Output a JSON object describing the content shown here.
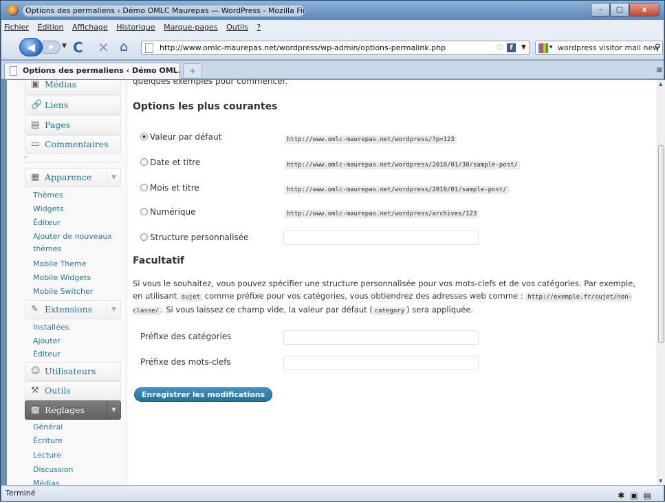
{
  "window": {
    "title": "Options des permaliens ‹ Démo OMLC Maurepas — WordPress - Mozilla Firefox",
    "min": "–",
    "max": "□",
    "close": "x"
  },
  "menubar": [
    "Fichier",
    "Édition",
    "Affichage",
    "Historique",
    "Marque-pages",
    "Outils",
    "?"
  ],
  "nav": {
    "url": "http://www.omlc-maurepas.net/wordpress/wp-admin/options-permalink.php",
    "search": "wordpress visitor mail new"
  },
  "tabs": [
    {
      "label": "Options des permaliens ‹ Démo OML..."
    }
  ],
  "sidebar": {
    "medias": "Médias",
    "liens": "Liens",
    "pages": "Pages",
    "commentaires": "Commentaires",
    "apparence": "Apparence",
    "apparence_sub": [
      "Thèmes",
      "Widgets",
      "Éditeur",
      "Ajouter de nouveaux",
      "thèmes",
      "Mobile Theme",
      "Mobile Widgets",
      "Mobile Switcher"
    ],
    "extensions": "Extensions",
    "extensions_sub": [
      "Installées",
      "Ajouter",
      "Éditeur"
    ],
    "utilisateurs": "Utilisateurs",
    "outils": "Outils",
    "reglages": "Réglages",
    "reglages_sub": [
      "Général",
      "Écriture",
      "Lecture",
      "Discussion",
      "Médias"
    ]
  },
  "main": {
    "intro_tail": "quelques exemples pour commencer.",
    "common_title": "Options les plus courantes",
    "options": [
      {
        "label": "Valeur par défaut",
        "example": "http://www.omlc-maurepas.net/wordpress/?p=123",
        "selected": true
      },
      {
        "label": "Date et titre",
        "example": "http://www.omlc-maurepas.net/wordpress/2010/01/30/sample-post/",
        "selected": false
      },
      {
        "label": "Mois et titre",
        "example": "http://www.omlc-maurepas.net/wordpress/2010/01/sample-post/",
        "selected": false
      },
      {
        "label": "Numérique",
        "example": "http://www.omlc-maurepas.net/wordpress/archives/123",
        "selected": false
      },
      {
        "label": "Structure personnalisée",
        "example": "",
        "selected": false
      }
    ],
    "optional_title": "Facultatif",
    "para": {
      "p1": "Si vous le souhaitez, vous pouvez spécifier une structure personnalisée pour vos mots-clefs et de vos catégories. Par exemple, en utilisant ",
      "code1": "sujet",
      "p2": " comme préfixe pour vos catégories, vous obtiendrez des adresses web comme : ",
      "code2": "http://exemple.fr/sujet/non-classe/",
      "p3": ". Si vous laissez ce champ vide, la valeur par défaut (",
      "code3": "category",
      "p4": ") sera appliquée."
    },
    "category_prefix_label": "Préfixe des catégories",
    "tag_prefix_label": "Préfixe des mots-clefs",
    "save_label": "Enregistrer les modifications"
  },
  "status": "Terminé"
}
